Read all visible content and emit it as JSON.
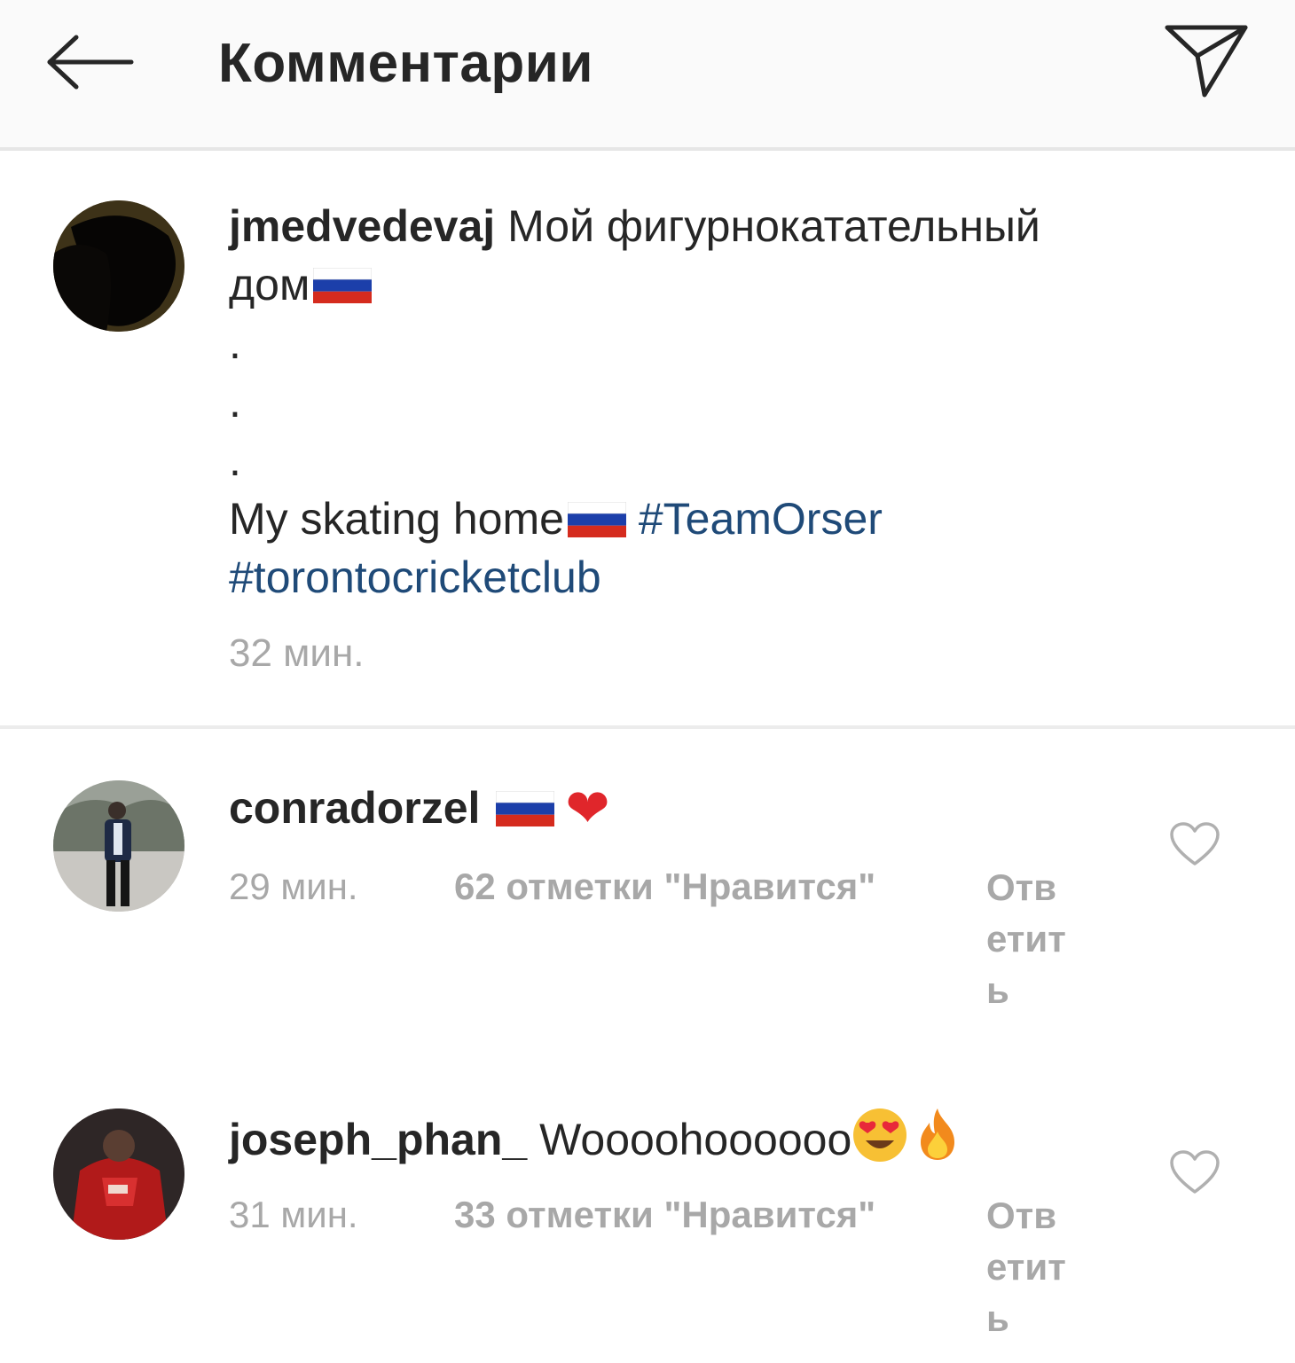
{
  "header": {
    "title": "Комментарии",
    "back_icon": "arrow-left-icon",
    "send_icon": "paper-plane-icon"
  },
  "caption": {
    "username": "jmedvedevaj",
    "text_line1": "Мой фигурнокатательный",
    "text_line2": "дом",
    "dots": [
      ".",
      ".",
      "."
    ],
    "english_text": "My skating home",
    "hashtag1": "#TeamOrser",
    "hashtag2": "#torontocricketclub",
    "time": "32 мин."
  },
  "comments": [
    {
      "username": "conradorzel",
      "text": "",
      "time": "29 мин.",
      "likes": "62 отметки \"Нравится\"",
      "reply": "Ответить"
    },
    {
      "username": "joseph_phan_",
      "text": "Woooohoooooo",
      "time": "31 мин.",
      "likes": "33 отметки \"Нравится\"",
      "reply": "Ответить"
    }
  ],
  "colors": {
    "hashtag": "#1f4a78",
    "muted": "#a8a8a8",
    "text": "#262626",
    "header_bg": "#fafafa"
  }
}
